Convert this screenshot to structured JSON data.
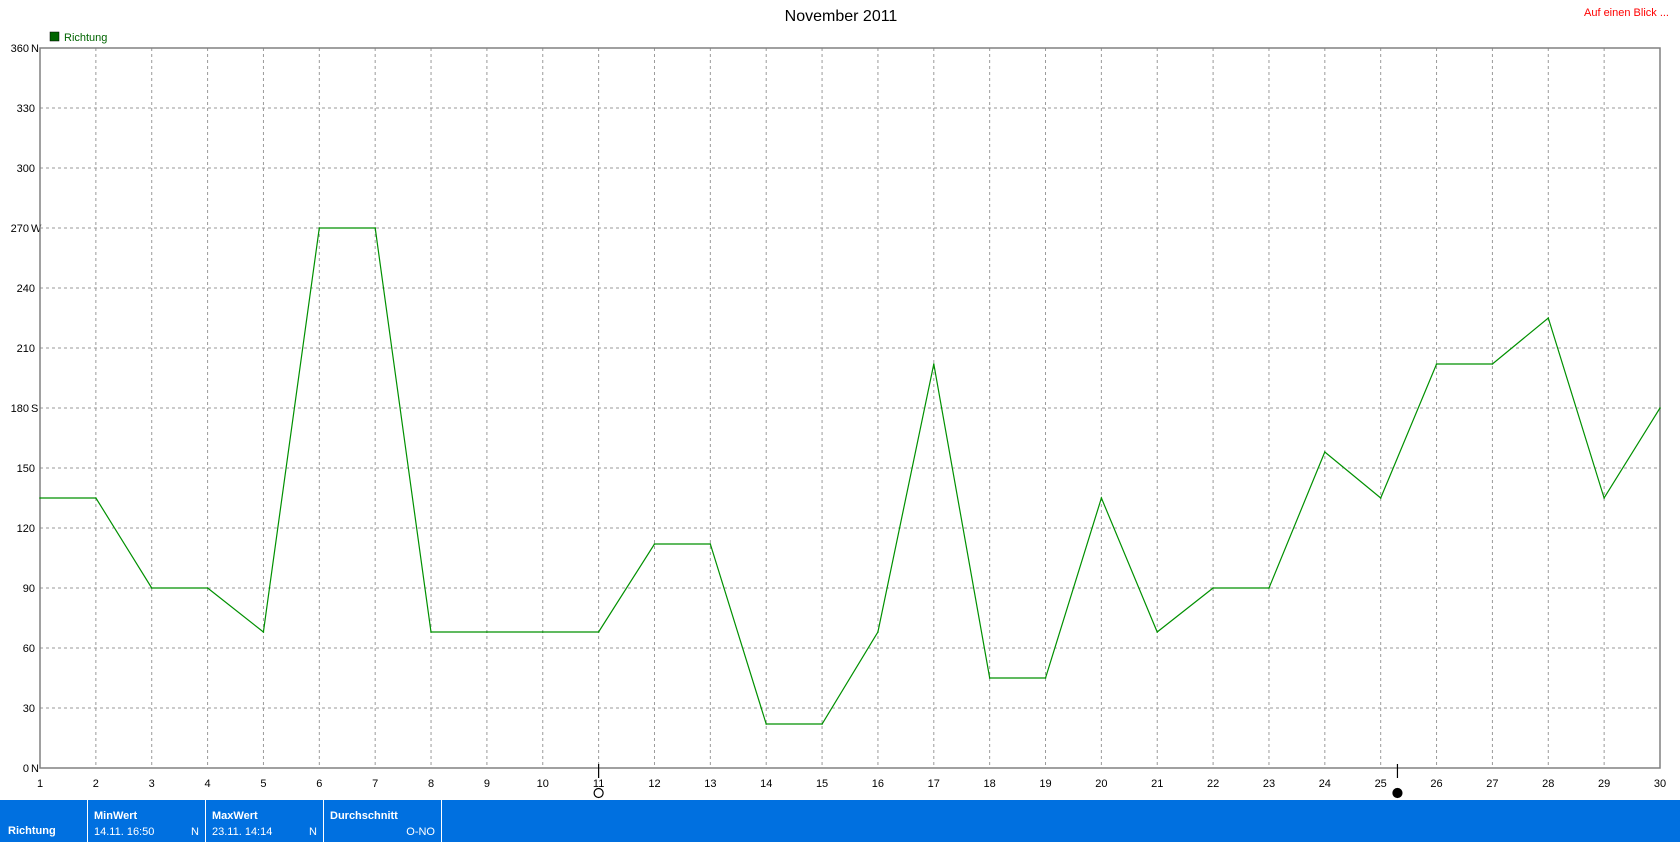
{
  "header": {
    "title": "November 2011",
    "link_label": "Auf einen Blick ..."
  },
  "legend": {
    "label": "Richtung",
    "color": "#006400"
  },
  "chart_data": {
    "type": "line",
    "title": "November 2011",
    "x": [
      1,
      2,
      3,
      4,
      5,
      6,
      7,
      8,
      9,
      10,
      11,
      12,
      13,
      14,
      15,
      16,
      17,
      18,
      19,
      20,
      21,
      22,
      23,
      24,
      25,
      26,
      27,
      28,
      29,
      30
    ],
    "series": [
      {
        "name": "Richtung",
        "color": "#009000",
        "values": [
          135,
          135,
          90,
          90,
          68,
          270,
          270,
          68,
          68,
          68,
          68,
          112,
          112,
          22,
          22,
          68,
          202,
          45,
          45,
          135,
          68,
          90,
          90,
          158,
          135,
          202,
          202,
          225,
          135,
          180
        ]
      }
    ],
    "xlim": [
      1,
      30
    ],
    "ylim": [
      0,
      360
    ],
    "yticks": [
      {
        "value": 0,
        "label": "0",
        "dir": "N"
      },
      {
        "value": 30,
        "label": "30",
        "dir": ""
      },
      {
        "value": 60,
        "label": "60",
        "dir": ""
      },
      {
        "value": 90,
        "label": "90",
        "dir": ""
      },
      {
        "value": 120,
        "label": "120",
        "dir": ""
      },
      {
        "value": 150,
        "label": "150",
        "dir": ""
      },
      {
        "value": 180,
        "label": "180",
        "dir": "S"
      },
      {
        "value": 210,
        "label": "210",
        "dir": ""
      },
      {
        "value": 240,
        "label": "240",
        "dir": ""
      },
      {
        "value": 270,
        "label": "270",
        "dir": "W"
      },
      {
        "value": 300,
        "label": "300",
        "dir": ""
      },
      {
        "value": 330,
        "label": "330",
        "dir": ""
      },
      {
        "value": 360,
        "label": "360",
        "dir": "N"
      }
    ],
    "grid": true,
    "legend_position": "top-left",
    "moon_phases": [
      {
        "day": 11,
        "phase": "full-moon"
      },
      {
        "day": 25.3,
        "phase": "new-moon"
      }
    ]
  },
  "footer": {
    "series_label": "Richtung",
    "min": {
      "label": "MinWert",
      "value": "14.11.  16:50",
      "unit": "N"
    },
    "max": {
      "label": "MaxWert",
      "value": "23.11.  14:14",
      "unit": "N"
    },
    "avg": {
      "label": "Durchschnitt",
      "value": "O-NO"
    }
  }
}
